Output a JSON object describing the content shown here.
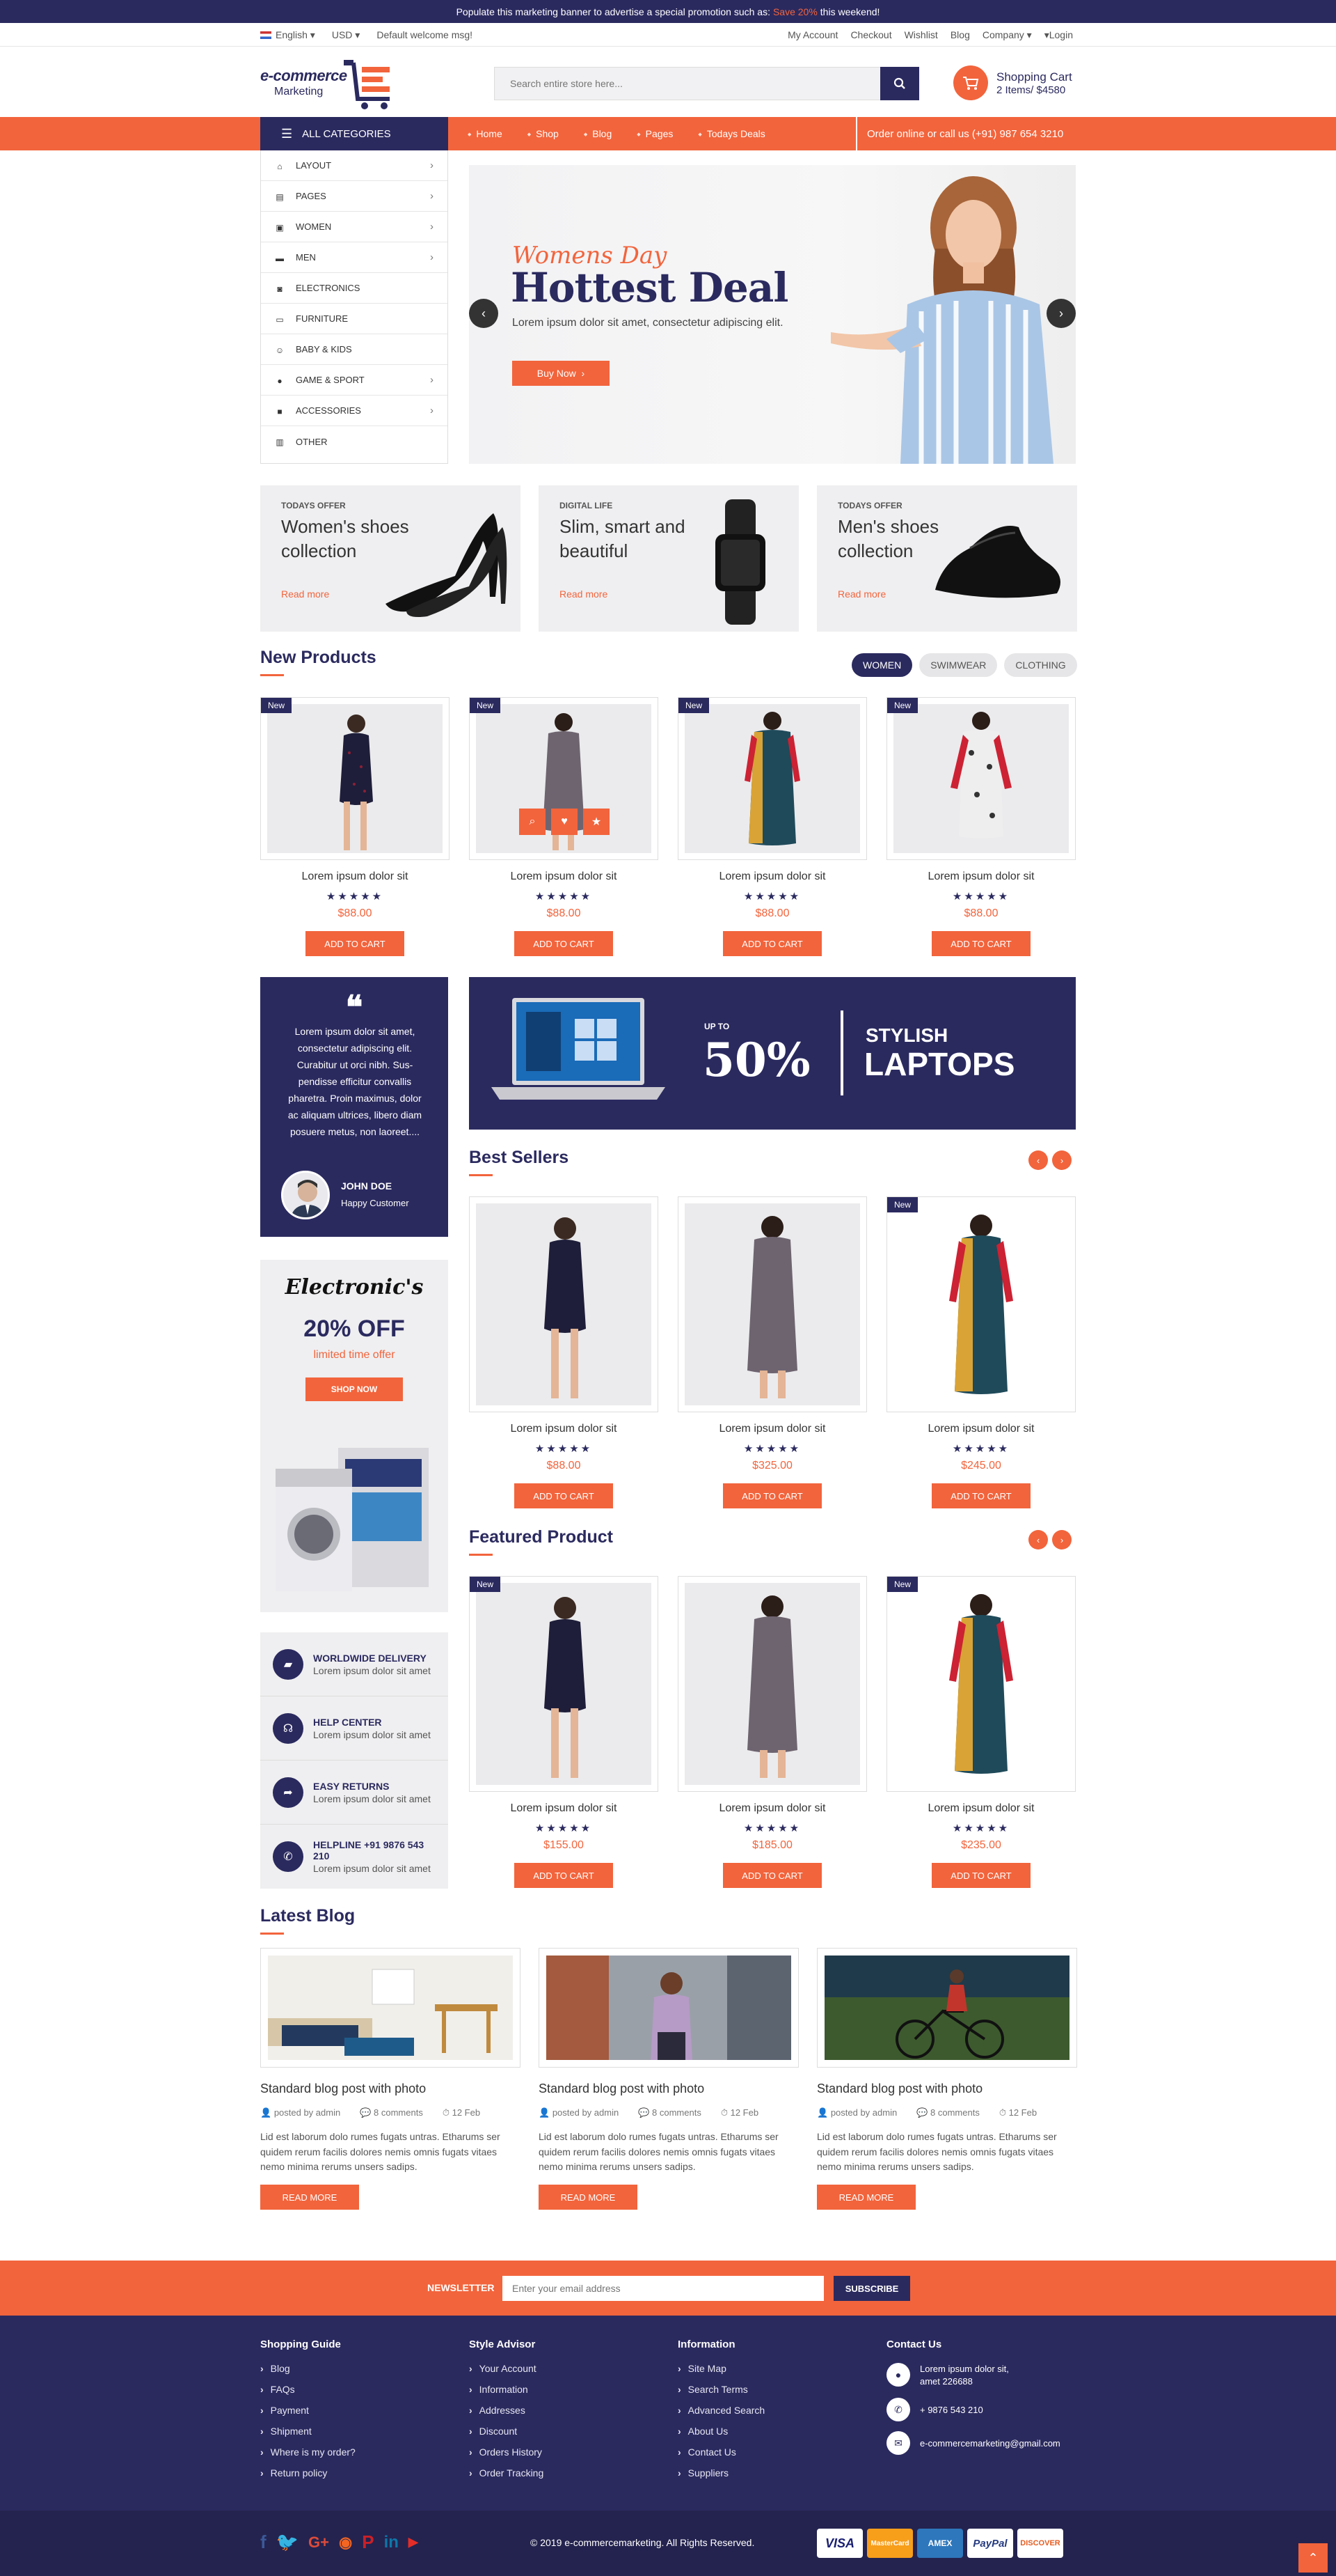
{
  "promo": {
    "text": "Populate this marketing banner to advertise a special promotion such as:",
    "highlight": "Save 20%",
    "end": "this weekend!"
  },
  "topbar": {
    "language": "English",
    "currency": "USD",
    "welcome": "Default welcome msg!",
    "links": [
      "My Account",
      "Checkout",
      "Wishlist",
      "Blog",
      "Company"
    ],
    "login": "Login"
  },
  "logo": {
    "line1": "e-commerce",
    "line2": "Marketing"
  },
  "search": {
    "placeholder": "Search entire store here..."
  },
  "cart": {
    "title": "Shopping Cart",
    "summary": "2 Items/ $4580"
  },
  "nav": {
    "all_categories": "ALL CATEGORIES",
    "items": [
      "Home",
      "Shop",
      "Blog",
      "Pages",
      "Todays Deals"
    ],
    "order_line": "Order online or call us (+91) 987 654 3210"
  },
  "categories": [
    {
      "label": "LAYOUT",
      "icon": "home-icon",
      "arrow": true
    },
    {
      "label": "PAGES",
      "icon": "file-icon",
      "arrow": true
    },
    {
      "label": "WOMEN",
      "icon": "gift-icon",
      "arrow": true
    },
    {
      "label": "MEN",
      "icon": "briefcase-icon",
      "arrow": true
    },
    {
      "label": "ELECTRONICS",
      "icon": "camera-icon",
      "arrow": false
    },
    {
      "label": "FURNITURE",
      "icon": "bed-icon",
      "arrow": false
    },
    {
      "label": "BABY & KIDS",
      "icon": "child-icon",
      "arrow": false
    },
    {
      "label": "GAME & SPORT",
      "icon": "ball-icon",
      "arrow": true
    },
    {
      "label": "ACCESSORIES",
      "icon": "bag-icon",
      "arrow": true
    },
    {
      "label": "OTHER",
      "icon": "basket-icon",
      "arrow": false
    }
  ],
  "hero": {
    "subtitle": "Womens Day",
    "title": "Hottest Deal",
    "text": "Lorem ipsum dolor sit amet, consectetur adipiscing elit.",
    "button": "Buy Now"
  },
  "promo_boxes": [
    {
      "kicker": "TODAYS OFFER",
      "title": "Women's shoes collection",
      "link": "Read more"
    },
    {
      "kicker": "DIGITAL LIFE",
      "title": "Slim, smart and beautiful",
      "link": "Read more"
    },
    {
      "kicker": "TODAYS OFFER",
      "title": "Men's shoes collection",
      "link": "Read more"
    }
  ],
  "new_products": {
    "title": "New Products",
    "filters": [
      "WOMEN",
      "SWIMWEAR",
      "CLOTHING"
    ],
    "items": [
      {
        "badge": "New",
        "name": "Lorem ipsum dolor sit",
        "stars": "★★★★★",
        "price": "$88.00",
        "button": "ADD TO CART"
      },
      {
        "badge": "New",
        "name": "Lorem ipsum dolor sit",
        "stars": "★★★★★",
        "price": "$88.00",
        "button": "ADD TO CART"
      },
      {
        "badge": "New",
        "name": "Lorem ipsum dolor sit",
        "stars": "★★★★★",
        "price": "$88.00",
        "button": "ADD TO CART"
      },
      {
        "badge": "New",
        "name": "Lorem ipsum dolor sit",
        "stars": "★★★★★",
        "price": "$88.00",
        "button": "ADD TO CART"
      }
    ]
  },
  "testimonial": {
    "text": "Lorem ipsum dolor sit amet, consectetur adipiscing elit. Curabitur ut orci nibh. Sus-pendisse efficitur convallis pharetra. Proin maximus, dolor ac aliquam ultrices, libero diam posuere metus, non laoreet....",
    "name": "JOHN DOE",
    "role": "Happy Customer"
  },
  "laptop_banner": {
    "upto": "UP TO",
    "percent": "50%",
    "line1": "STYLISH",
    "line2": "LAPTOPS"
  },
  "best_sellers": {
    "title": "Best Sellers",
    "items": [
      {
        "badge": "",
        "name": "Lorem ipsum dolor sit",
        "stars": "★★★★★",
        "price": "$88.00",
        "button": "ADD TO CART"
      },
      {
        "badge": "",
        "name": "Lorem ipsum dolor sit",
        "stars": "★★★★★",
        "price": "$325.00",
        "button": "ADD TO CART"
      },
      {
        "badge": "New",
        "name": "Lorem ipsum dolor sit",
        "stars": "★★★★★",
        "price": "$245.00",
        "button": "ADD TO CART"
      }
    ]
  },
  "electronics_promo": {
    "title": "Electronic's",
    "offer": "20% OFF",
    "note": "limited time offer",
    "button": "SHOP NOW"
  },
  "featured": {
    "title": "Featured Product",
    "items": [
      {
        "badge": "New",
        "name": "Lorem ipsum dolor sit",
        "stars": "★★★★★",
        "price": "$155.00",
        "button": "ADD TO CART"
      },
      {
        "badge": "",
        "name": "Lorem ipsum dolor sit",
        "stars": "★★★★★",
        "price": "$185.00",
        "button": "ADD TO CART"
      },
      {
        "badge": "New",
        "name": "Lorem ipsum dolor sit",
        "stars": "★★★★★",
        "price": "$235.00",
        "button": "ADD TO CART"
      }
    ]
  },
  "services": [
    {
      "title": "WORLDWIDE DELIVERY",
      "text": "Lorem ipsum dolor sit amet",
      "icon": "truck-icon"
    },
    {
      "title": "HELP CENTER",
      "text": "Lorem ipsum dolor sit amet",
      "icon": "headset-icon"
    },
    {
      "title": "EASY RETURNS",
      "text": "Lorem ipsum dolor sit amet",
      "icon": "share-icon"
    },
    {
      "title": "HELPLINE +91 9876 543 210",
      "text": "Lorem ipsum dolor sit amet",
      "icon": "phone-icon"
    }
  ],
  "blog": {
    "title": "Latest Blog",
    "posts": [
      {
        "title": "Standard blog post with photo",
        "author": "posted by admin",
        "comments": "8 comments",
        "date": "12 Feb",
        "text": "Lid est laborum dolo rumes fugats untras. Etharums ser quidem rerum facilis dolores nemis omnis fugats vitaes nemo minima rerums unsers sadips.",
        "button": "READ MORE"
      },
      {
        "title": "Standard blog post with photo",
        "author": "posted by admin",
        "comments": "8 comments",
        "date": "12 Feb",
        "text": "Lid est laborum dolo rumes fugats untras. Etharums ser quidem rerum facilis dolores nemis omnis fugats vitaes nemo minima rerums unsers sadips.",
        "button": "READ MORE"
      },
      {
        "title": "Standard blog post with photo",
        "author": "posted by admin",
        "comments": "8 comments",
        "date": "12 Feb",
        "text": "Lid est laborum dolo rumes fugats untras. Etharums ser quidem rerum facilis dolores nemis omnis fugats vitaes nemo minima rerums unsers sadips.",
        "button": "READ MORE"
      }
    ]
  },
  "newsletter": {
    "label": "NEWSLETTER",
    "placeholder": "Enter your email address",
    "button": "SUBSCRIBE"
  },
  "footer": {
    "cols": [
      {
        "title": "Shopping Guide",
        "links": [
          "Blog",
          "FAQs",
          "Payment",
          "Shipment",
          "Where is my order?",
          "Return policy"
        ]
      },
      {
        "title": "Style Advisor",
        "links": [
          "Your Account",
          "Information",
          "Addresses",
          "Discount",
          "Orders History",
          "Order Tracking"
        ]
      },
      {
        "title": "Information",
        "links": [
          "Site Map",
          "Search Terms",
          "Advanced Search",
          "About Us",
          "Contact Us",
          "Suppliers"
        ]
      }
    ],
    "contact": {
      "title": "Contact Us",
      "address": "Lorem ipsum dolor sit, amet 226688",
      "phone": "+ 9876 543 210",
      "email": "e-commercemarketing@gmail.com"
    },
    "copyright": "© 2019 e-commercemarketing. All Rights Reserved.",
    "payments": [
      "VISA",
      "MasterCard",
      "AMEX",
      "PayPal",
      "DISCOVER"
    ],
    "social": [
      "facebook-icon",
      "twitter-icon",
      "google-plus-icon",
      "rss-icon",
      "pinterest-icon",
      "linkedin-icon",
      "youtube-icon"
    ]
  },
  "colors": {
    "navy": "#2b2a5f",
    "orange": "#f2643c"
  }
}
